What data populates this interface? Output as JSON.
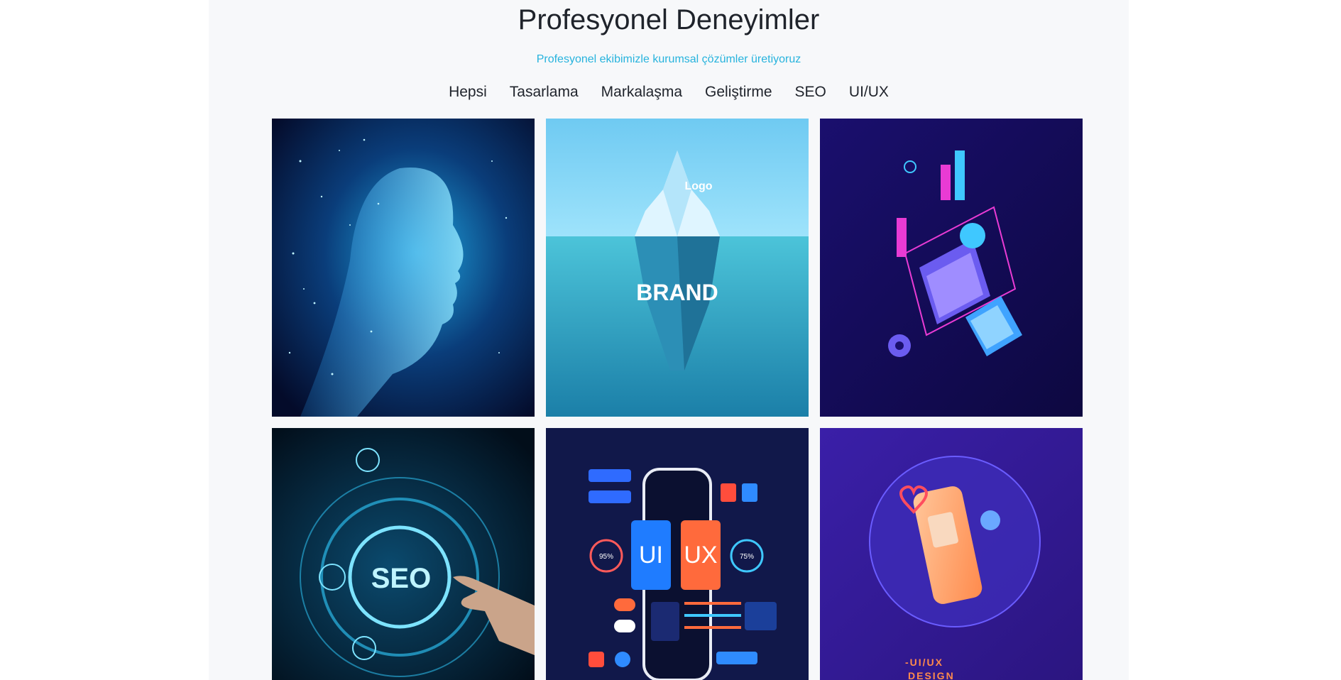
{
  "header": {
    "title": "Profesyonel Deneyimler",
    "subtitle": "Profesyonel ekibimizle kurumsal çözümler üretiyoruz"
  },
  "filters": [
    {
      "label": "Hepsi"
    },
    {
      "label": "Tasarlama"
    },
    {
      "label": "Markalaşma"
    },
    {
      "label": "Geliştirme"
    },
    {
      "label": "SEO"
    },
    {
      "label": "UI/UX"
    }
  ],
  "gallery": {
    "brand_image": {
      "logo_text": "Logo",
      "brand_text": "BRAND"
    },
    "seo_image": {
      "text": "SEO"
    },
    "uiux_image": {
      "ui_text": "UI",
      "ux_text": "UX",
      "left_percent": "95%",
      "right_percent": "75%"
    },
    "design_image": {
      "caption": "-UI/UX",
      "caption2": "DESIGN"
    }
  },
  "colors": {
    "accent": "#27b3dd",
    "section_bg": "#f7f8fa",
    "heading": "#1f232b"
  }
}
